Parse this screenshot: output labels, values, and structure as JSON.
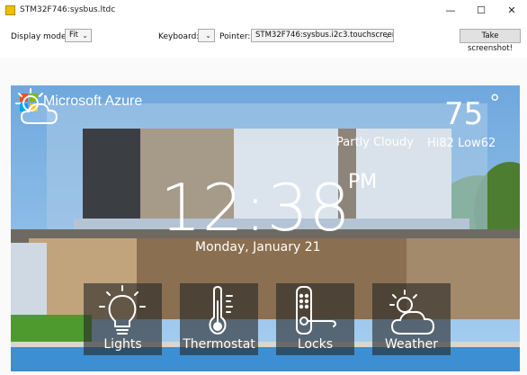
{
  "window": {
    "title": "STM32F746:sysbus.ltdc",
    "minimize": "—",
    "maximize": "☐",
    "close": "✕"
  },
  "toolbar": {
    "display_mode_label": "Display mode:",
    "display_mode_value": "Fit",
    "keyboard_label": "Keyboard:",
    "keyboard_value": "",
    "pointer_label": "Pointer:",
    "pointer_value": "STM32F746:sysbus.i2c3.touchscreen",
    "screenshot_button": "Take screenshot!"
  },
  "device_screen": {
    "brand": "Microsoft Azure",
    "brand_colors": [
      "#f25022",
      "#7fba00",
      "#00a4ef",
      "#ffb900"
    ],
    "weather": {
      "icon": "partly-cloudy-icon",
      "temperature": "75",
      "degree_symbol": "°",
      "condition": "Partly Cloudy",
      "hi_label": "Hi",
      "hi_value": "82",
      "low_label": "Low",
      "low_value": "62"
    },
    "clock": {
      "time": "12:38",
      "ampm": "PM",
      "date": "Monday, January 21"
    },
    "tiles": [
      {
        "label": "Lights",
        "icon": "lightbulb-icon"
      },
      {
        "label": "Thermostat",
        "icon": "thermometer-icon"
      },
      {
        "label": "Locks",
        "icon": "door-lock-icon"
      },
      {
        "label": "Weather",
        "icon": "partly-cloudy-icon"
      }
    ]
  }
}
